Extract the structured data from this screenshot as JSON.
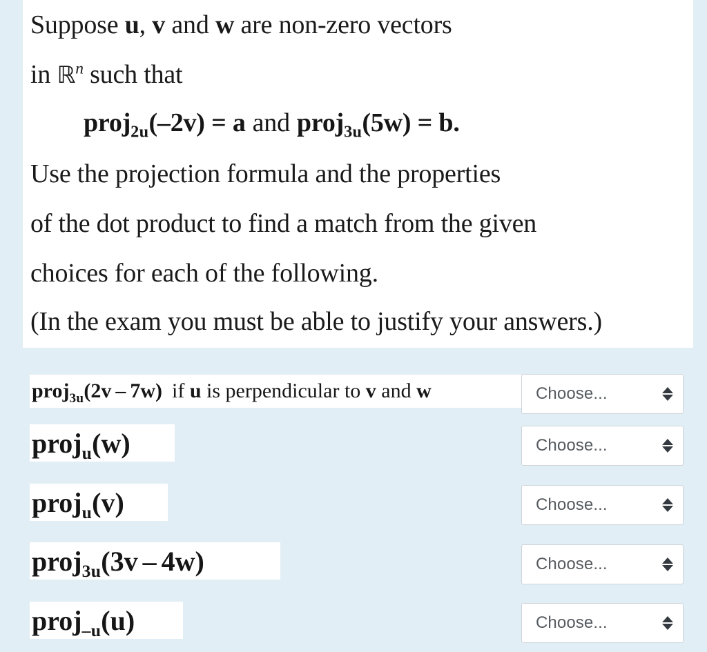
{
  "prompt": {
    "line1_a": "Suppose ",
    "line1_u": "u",
    "line1_b": ", ",
    "line1_v": "v",
    "line1_c": " and ",
    "line1_w": "w",
    "line1_d": " are non-zero vectors",
    "line2_a": "in ",
    "line2_R": "ℝ",
    "line2_n": "n",
    "line2_b": " such that",
    "formula_proj1": "proj",
    "formula_sub1": "2u",
    "formula_arg1": "(–2v)",
    "formula_eq1": " = ",
    "formula_res1": "a",
    "formula_and": "and",
    "formula_proj2": "proj",
    "formula_sub2": "3u",
    "formula_arg2": "(5w)",
    "formula_eq2": " = ",
    "formula_res2": "b.",
    "line4": "Use the projection formula and the properties",
    "line5": "of the dot product to find a match from the given",
    "line6": "choices for each of the following.",
    "line7": "(In the exam you must be able to justify your answers.)"
  },
  "questions": [
    {
      "id": "q1",
      "proj": "proj",
      "sub": "3u",
      "arg_open": "(2",
      "arg_v": "v",
      "arg_op": "–",
      "arg_num2": "7",
      "arg_w": "w",
      "arg_close": ")",
      "condition_a": "if ",
      "condition_u": "u",
      "condition_b": " is perpendicular to ",
      "condition_v": "v",
      "condition_c": " and ",
      "condition_w": "w",
      "select_value": "Choose..."
    },
    {
      "id": "q2",
      "proj": "proj",
      "sub": "u",
      "arg_open": "(",
      "arg_w": "w",
      "arg_close": ")",
      "select_value": "Choose..."
    },
    {
      "id": "q3",
      "proj": "proj",
      "sub": "u",
      "arg_open": "(",
      "arg_v": "v",
      "arg_close": ")",
      "select_value": "Choose..."
    },
    {
      "id": "q4",
      "proj": "proj",
      "sub": "3u",
      "arg_open": "(3",
      "arg_v": "v",
      "arg_op": "–",
      "arg_num2": "4",
      "arg_w": "w",
      "arg_close": ")",
      "select_value": "Choose..."
    },
    {
      "id": "q5",
      "proj": "proj",
      "sub": "–u",
      "arg_open": "(",
      "arg_u": "u",
      "arg_close": ")",
      "select_value": "Choose..."
    }
  ],
  "colors": {
    "page_background": "#e2eef5",
    "panel_background": "#ffffff",
    "text": "#161616",
    "select_border": "#ced4da",
    "select_text": "#555b60",
    "arrow": "#343a40"
  }
}
